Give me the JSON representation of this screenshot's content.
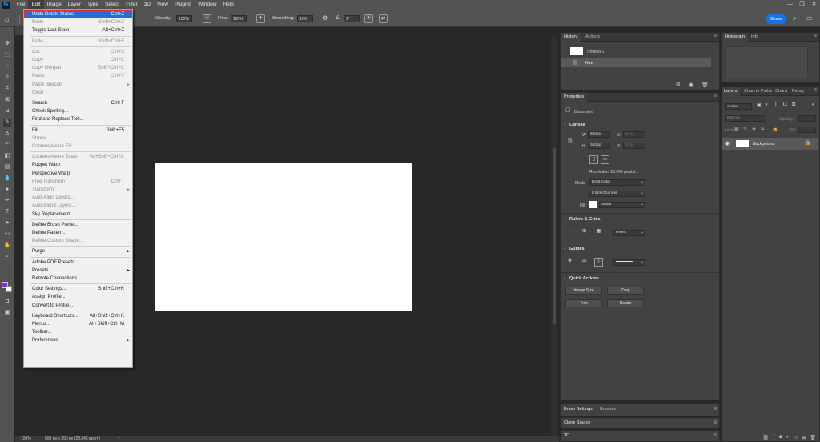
{
  "menubar": {
    "logo": "Ps",
    "items": [
      "File",
      "Edit",
      "Image",
      "Layer",
      "Type",
      "Select",
      "Filter",
      "3D",
      "View",
      "Plugins",
      "Window",
      "Help"
    ],
    "window_controls": [
      "—",
      "❐",
      "✕"
    ]
  },
  "options": {
    "opacity_label": "Opacity:",
    "opacity_value": "100%",
    "flow_label": "Flow:",
    "flow_value": "100%",
    "smoothing_label": "Smoothing:",
    "smoothing_value": "10%",
    "angle_value": "1°",
    "share_label": "Share"
  },
  "edit_menu": [
    {
      "label": "Undo Delete States",
      "shortcut": "Ctrl+Z",
      "enabled": true,
      "highlighted": true
    },
    {
      "label": "Redo",
      "shortcut": "Shift+Ctrl+Z",
      "enabled": false
    },
    {
      "label": "Toggle Last State",
      "shortcut": "Alt+Ctrl+Z",
      "enabled": true
    },
    {
      "sep": true
    },
    {
      "label": "Fade...",
      "shortcut": "Shift+Ctrl+F",
      "enabled": false
    },
    {
      "sep": true
    },
    {
      "label": "Cut",
      "shortcut": "Ctrl+X",
      "enabled": false
    },
    {
      "label": "Copy",
      "shortcut": "Ctrl+C",
      "enabled": false
    },
    {
      "label": "Copy Merged",
      "shortcut": "Shift+Ctrl+C",
      "enabled": false
    },
    {
      "label": "Paste",
      "shortcut": "Ctrl+V",
      "enabled": false
    },
    {
      "label": "Paste Special",
      "shortcut": "",
      "enabled": false,
      "submenu": true
    },
    {
      "label": "Clear",
      "shortcut": "",
      "enabled": false
    },
    {
      "sep": true
    },
    {
      "label": "Search",
      "shortcut": "Ctrl+F",
      "enabled": true
    },
    {
      "label": "Check Spelling...",
      "shortcut": "",
      "enabled": true
    },
    {
      "label": "Find and Replace Text...",
      "shortcut": "",
      "enabled": true
    },
    {
      "sep": true
    },
    {
      "label": "Fill...",
      "shortcut": "Shift+F5",
      "enabled": true
    },
    {
      "label": "Stroke...",
      "shortcut": "",
      "enabled": false
    },
    {
      "label": "Content-Aware Fill...",
      "shortcut": "",
      "enabled": false
    },
    {
      "sep": true
    },
    {
      "label": "Content-Aware Scale",
      "shortcut": "Alt+Shift+Ctrl+C",
      "enabled": false
    },
    {
      "label": "Puppet Warp",
      "shortcut": "",
      "enabled": true
    },
    {
      "label": "Perspective Warp",
      "shortcut": "",
      "enabled": true
    },
    {
      "label": "Free Transform",
      "shortcut": "Ctrl+T",
      "enabled": false
    },
    {
      "label": "Transform",
      "shortcut": "",
      "enabled": false,
      "submenu": true
    },
    {
      "label": "Auto-Align Layers...",
      "shortcut": "",
      "enabled": false
    },
    {
      "label": "Auto-Blend Layers...",
      "shortcut": "",
      "enabled": false
    },
    {
      "label": "Sky Replacement...",
      "shortcut": "",
      "enabled": true
    },
    {
      "sep": true
    },
    {
      "label": "Define Brush Preset...",
      "shortcut": "",
      "enabled": true
    },
    {
      "label": "Define Pattern...",
      "shortcut": "",
      "enabled": true
    },
    {
      "label": "Define Custom Shape...",
      "shortcut": "",
      "enabled": false
    },
    {
      "sep": true
    },
    {
      "label": "Purge",
      "shortcut": "",
      "enabled": true,
      "submenu": true
    },
    {
      "sep": true
    },
    {
      "label": "Adobe PDF Presets...",
      "shortcut": "",
      "enabled": true
    },
    {
      "label": "Presets",
      "shortcut": "",
      "enabled": true,
      "submenu": true
    },
    {
      "label": "Remote Connections...",
      "shortcut": "",
      "enabled": true
    },
    {
      "sep": true
    },
    {
      "label": "Color Settings...",
      "shortcut": "Shift+Ctrl+K",
      "enabled": true
    },
    {
      "label": "Assign Profile...",
      "shortcut": "",
      "enabled": true
    },
    {
      "label": "Convert to Profile...",
      "shortcut": "",
      "enabled": true
    },
    {
      "sep": true
    },
    {
      "label": "Keyboard Shortcuts...",
      "shortcut": "Alt+Shift+Ctrl+K",
      "enabled": true
    },
    {
      "label": "Menus...",
      "shortcut": "Alt+Shift+Ctrl+M",
      "enabled": true
    },
    {
      "label": "Toolbar...",
      "shortcut": "",
      "enabled": true
    },
    {
      "label": "Preferences",
      "shortcut": "",
      "enabled": true,
      "submenu": true
    }
  ],
  "history": {
    "tabs": [
      "History",
      "Actions"
    ],
    "snapshot": "Untitled-1",
    "state": "New"
  },
  "properties": {
    "tab": "Properties",
    "doc_label": "Document",
    "canvas_title": "Canvas",
    "w_label": "W",
    "w_value": "600 px",
    "h_label": "H",
    "h_value": "350 px",
    "x_label": "X",
    "x_value": "0 px",
    "y_label": "Y",
    "y_value": "0 px",
    "resolution": "Resolution:  28.346  pixels/...",
    "mode_label": "Mode",
    "mode_value": "RGB Color",
    "depth_value": "8 Bits/Channel",
    "fill_label": "Fill",
    "fill_value": "White",
    "rulers_title": "Rulers & Grids",
    "units_value": "Pixels",
    "guides_title": "Guides",
    "quick_title": "Quick Actions",
    "btn_image_size": "Image Size",
    "btn_crop": "Crop",
    "btn_trim": "Trim",
    "btn_rotate": "Rotate"
  },
  "histogram": {
    "tabs": [
      "Histogram",
      "Info"
    ]
  },
  "layers": {
    "tabs": [
      "Layers",
      "Channe",
      "Paths",
      "Chara",
      "Parag"
    ],
    "search": "Kind",
    "blend": "Normal",
    "opacity_label": "Opacity:",
    "lock_label": "Lock:",
    "fill_label": "Fill:",
    "layer_name": "Background"
  },
  "bottom_panels": {
    "brush_tabs": [
      "Brush Settings",
      "Brushes"
    ],
    "clone": "Clone Source",
    "threed": "3D"
  },
  "status": {
    "zoom": "100%",
    "info": "600 px x 350 px (28.346 ppcm)"
  }
}
